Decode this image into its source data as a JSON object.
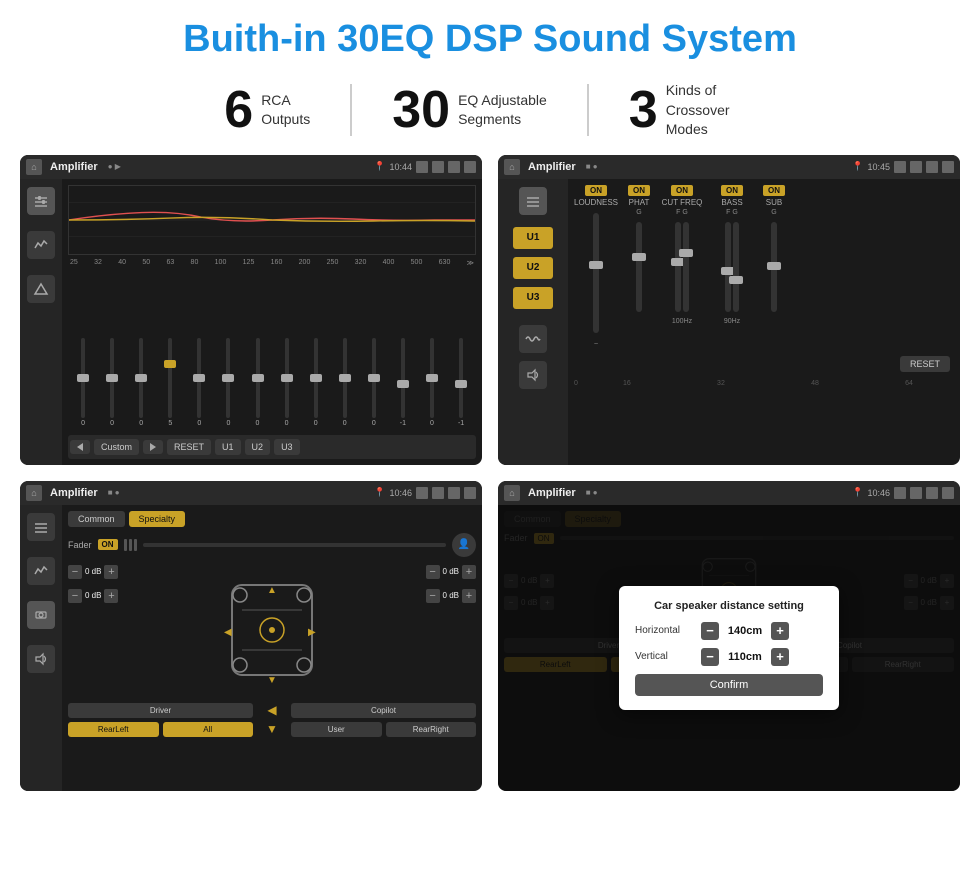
{
  "page": {
    "title": "Buith-in 30EQ DSP Sound System"
  },
  "stats": [
    {
      "number": "6",
      "label": "RCA\nOutputs"
    },
    {
      "number": "30",
      "label": "EQ Adjustable\nSegments"
    },
    {
      "number": "3",
      "label": "Kinds of\nCrossover Modes"
    }
  ],
  "screens": [
    {
      "id": "screen1",
      "statusbar": {
        "title": "Amplifier",
        "time": "10:44"
      },
      "type": "eq"
    },
    {
      "id": "screen2",
      "statusbar": {
        "title": "Amplifier",
        "time": "10:45"
      },
      "type": "amp"
    },
    {
      "id": "screen3",
      "statusbar": {
        "title": "Amplifier",
        "time": "10:46"
      },
      "type": "speaker"
    },
    {
      "id": "screen4",
      "statusbar": {
        "title": "Amplifier",
        "time": "10:46"
      },
      "type": "dialog"
    }
  ],
  "eq": {
    "frequencies": [
      "25",
      "32",
      "40",
      "50",
      "63",
      "80",
      "100",
      "125",
      "160",
      "200",
      "250",
      "320",
      "400",
      "500",
      "630"
    ],
    "values": [
      "0",
      "0",
      "0",
      "5",
      "0",
      "0",
      "0",
      "0",
      "0",
      "0",
      "0",
      "-1",
      "0",
      "-1"
    ],
    "sliders": [
      50,
      50,
      50,
      70,
      50,
      50,
      50,
      50,
      50,
      50,
      50,
      40,
      50,
      40,
      50
    ],
    "buttons": [
      "Custom",
      "RESET",
      "U1",
      "U2",
      "U3"
    ]
  },
  "amp": {
    "u_buttons": [
      "U1",
      "U2",
      "U3"
    ],
    "controls": [
      "LOUDNESS",
      "PHAT",
      "CUT FREQ",
      "BASS",
      "SUB"
    ],
    "reset_label": "RESET"
  },
  "speaker": {
    "tabs": [
      "Common",
      "Specialty"
    ],
    "fader_label": "Fader",
    "on_label": "ON",
    "db_values": [
      "0 dB",
      "0 dB",
      "0 dB",
      "0 dB"
    ],
    "nav_buttons": [
      "Driver",
      "All",
      "User",
      "Copilot",
      "RearLeft",
      "RearRight"
    ]
  },
  "dialog": {
    "title": "Car speaker distance setting",
    "horizontal_label": "Horizontal",
    "horizontal_value": "140cm",
    "vertical_label": "Vertical",
    "vertical_value": "110cm",
    "confirm_label": "Confirm",
    "minus": "−",
    "plus": "+"
  }
}
